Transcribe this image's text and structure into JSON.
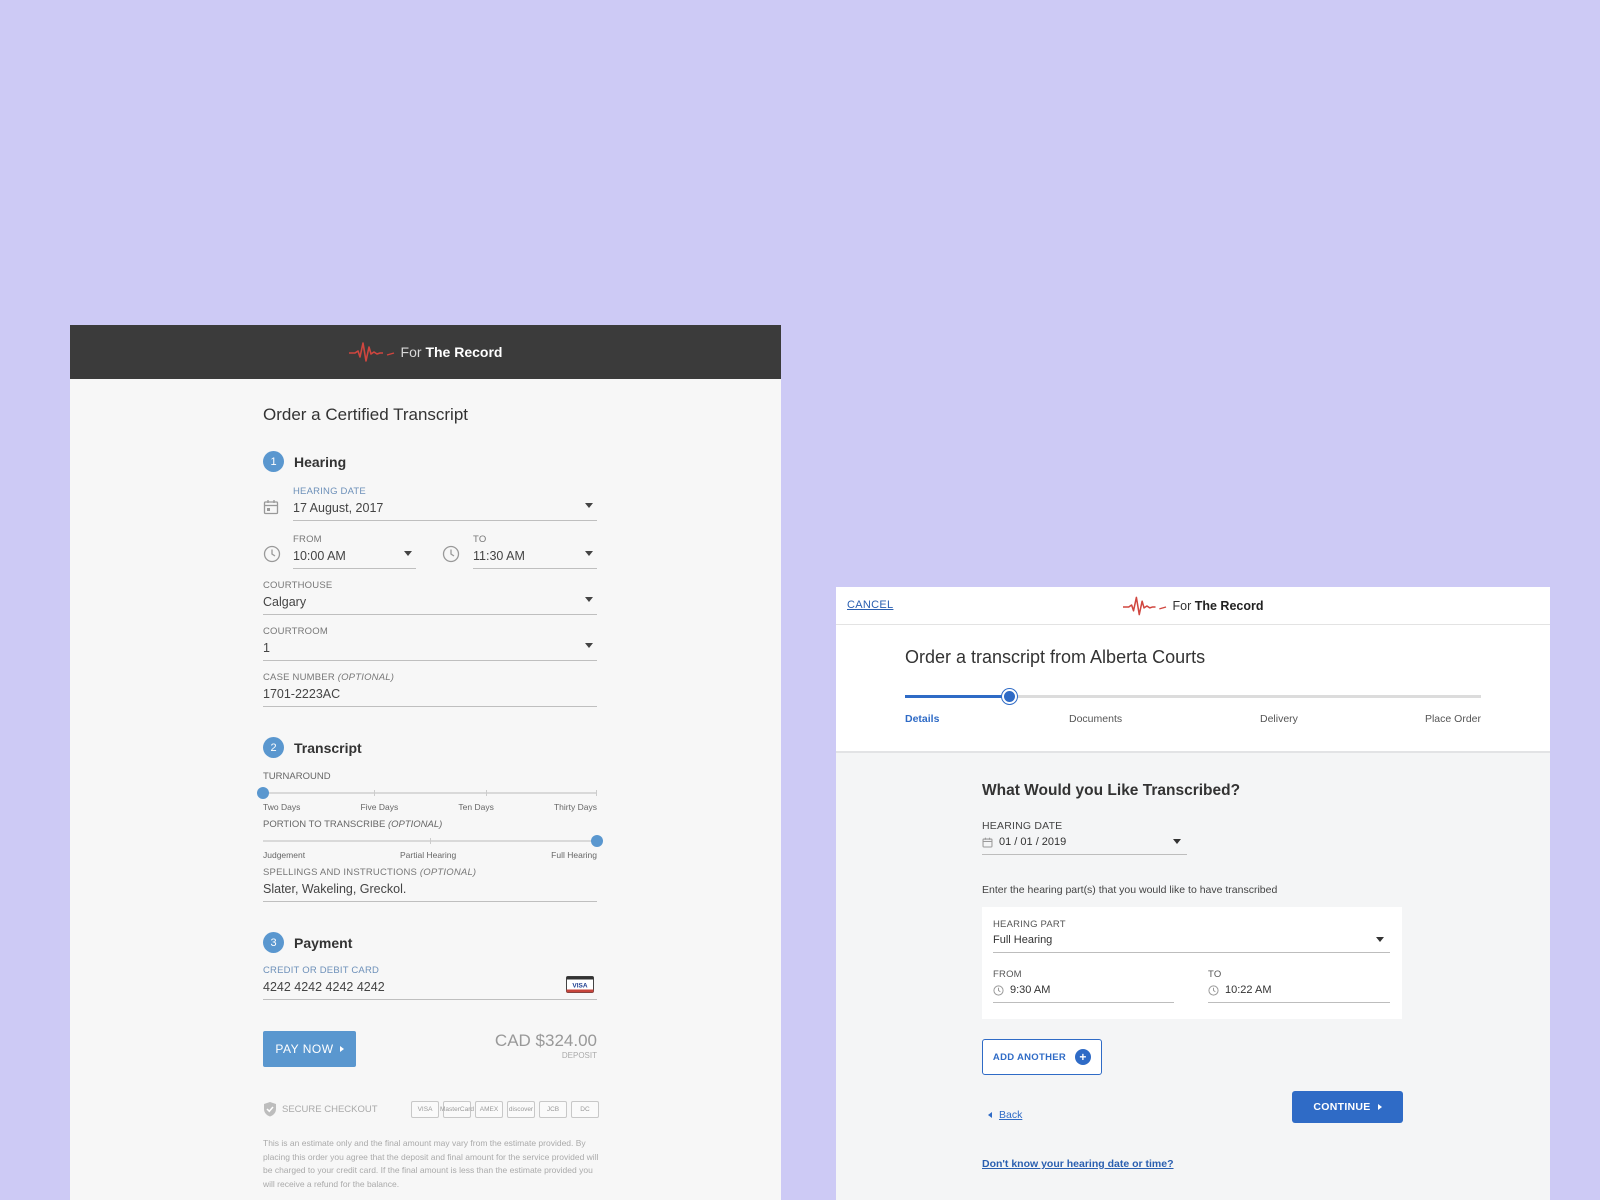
{
  "brand": {
    "prefix": "For",
    "name": "The Record",
    "accent": "#d0463f"
  },
  "left": {
    "title": "Order a Certified Transcript",
    "steps": [
      {
        "num": "1",
        "label": "Hearing"
      },
      {
        "num": "2",
        "label": "Transcript"
      },
      {
        "num": "3",
        "label": "Payment"
      }
    ],
    "hearing_date": {
      "label": "HEARING DATE",
      "value": "17 August, 2017"
    },
    "from": {
      "label": "FROM",
      "value": "10:00 AM"
    },
    "to": {
      "label": "TO",
      "value": "11:30 AM"
    },
    "courthouse": {
      "label": "COURTHOUSE",
      "value": "Calgary"
    },
    "courtroom": {
      "label": "COURTROOM",
      "value": "1"
    },
    "case_number": {
      "label": "CASE NUMBER",
      "optional": "(OPTIONAL)",
      "value": "1701-2223AC"
    },
    "turnaround": {
      "label": "TURNAROUND",
      "options": [
        "Two Days",
        "Five Days",
        "Ten Days",
        "Thirty Days"
      ],
      "selected_index": 0
    },
    "portion": {
      "label": "PORTION TO TRANSCRIBE",
      "optional": "(OPTIONAL)",
      "options": [
        "Judgement",
        "Partial Hearing",
        "Full Hearing"
      ],
      "selected_index": 2
    },
    "spellings": {
      "label": "SPELLINGS AND INSTRUCTIONS",
      "optional": "(OPTIONAL)",
      "value": "Slater, Wakeling, Greckol."
    },
    "card": {
      "label": "CREDIT OR DEBIT CARD",
      "value": "4242 4242 4242 4242",
      "brand": "VISA"
    },
    "pay_button": "PAY NOW",
    "amount": "CAD $324.00",
    "amount_sub": "DEPOSIT",
    "secure": "SECURE CHECKOUT",
    "card_logos": [
      "VISA",
      "MasterCard",
      "AMEX",
      "discover",
      "JCB",
      "DC"
    ],
    "disclaimer": "This is an estimate only and the final amount may vary from the estimate provided. By placing this order you agree that the deposit and final amount for the service provided will be charged to your credit card. If the final amount is less than the estimate provided you will receive a refund for the balance."
  },
  "right": {
    "cancel": "CANCEL",
    "title": "Order a transcript from Alberta Courts",
    "progress": 0.18,
    "steps": [
      "Details",
      "Documents",
      "Delivery",
      "Place Order"
    ],
    "active_step": 0,
    "question": "What Would you Like Transcribed?",
    "hearing_date": {
      "label": "HEARING DATE",
      "value": "01 / 01 / 2019"
    },
    "hint": "Enter the hearing part(s) that you would like to have transcribed",
    "hearing_part": {
      "label": "HEARING PART",
      "value": "Full Hearing"
    },
    "from": {
      "label": "FROM",
      "value": "9:30 AM"
    },
    "to": {
      "label": "TO",
      "value": "10:22 AM"
    },
    "add_another": "ADD ANOTHER",
    "back": "Back",
    "continue": "CONTINUE",
    "dont_know": "Don't know your hearing date or time?",
    "primary_color": "#2f6bc6"
  }
}
